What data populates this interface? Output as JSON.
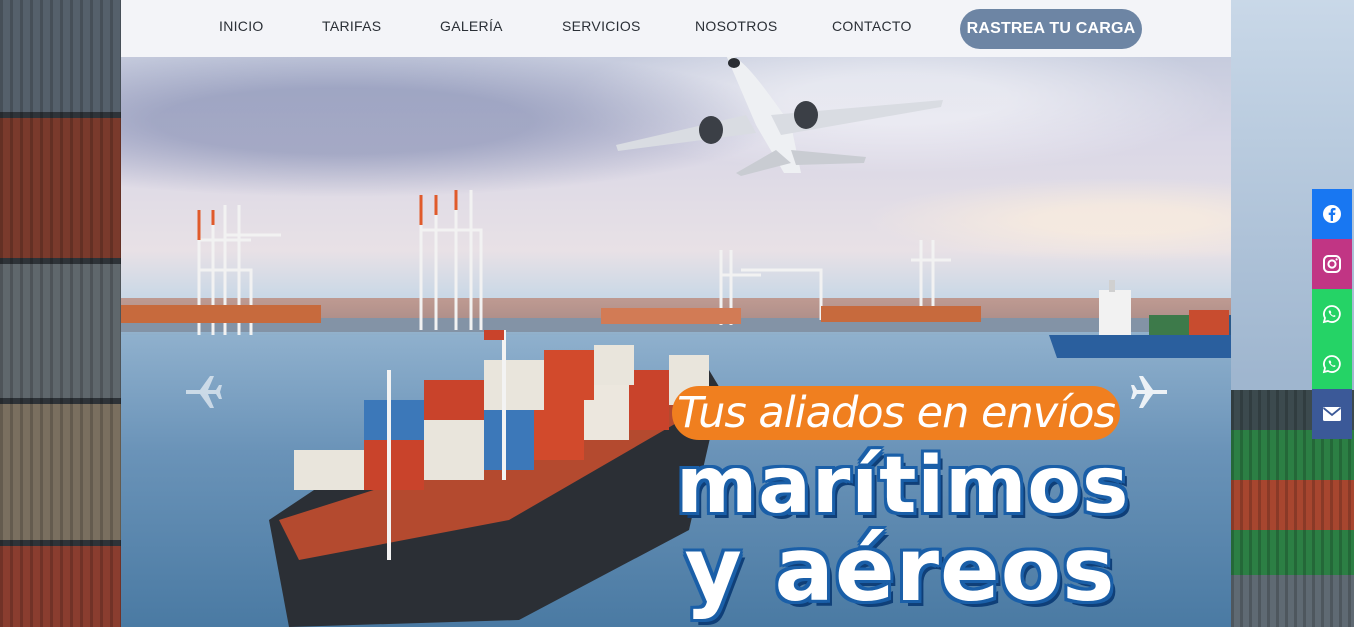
{
  "nav": {
    "items": [
      {
        "label": "INICIO"
      },
      {
        "label": "TARIFAS"
      },
      {
        "label": "GALERÍA"
      },
      {
        "label": "SERVICIOS"
      },
      {
        "label": "NOSOTROS"
      },
      {
        "label": "CONTACTO"
      }
    ],
    "cta_label": "RASTREA TU CARGA"
  },
  "hero": {
    "tagline": "Tus aliados en envíos",
    "headline_line1": "marítimos",
    "headline_line2": "y aéreos",
    "slider_prev_icon": "airplane-left-icon",
    "slider_next_icon": "airplane-right-icon"
  },
  "social": [
    {
      "icon": "facebook-icon",
      "color": "#1877f2"
    },
    {
      "icon": "instagram-icon",
      "color": "#c13584"
    },
    {
      "icon": "whatsapp-icon",
      "color": "#25d366"
    },
    {
      "icon": "whatsapp-icon",
      "color": "#25d366"
    },
    {
      "icon": "email-icon",
      "color": "#3b5998"
    }
  ],
  "colors": {
    "accent_orange": "#f07f1f",
    "headline_blue": "#1a5fa8",
    "cta_bg": "#6d85a4",
    "nav_bg": "#f3f4f8"
  }
}
